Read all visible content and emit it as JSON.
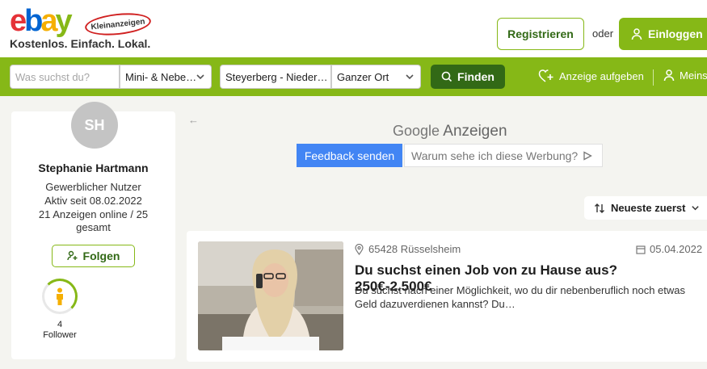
{
  "header": {
    "logo_ebay": "ebay",
    "logo_sub": "Kleinanzeigen",
    "tagline": "Kostenlos. Einfach. Lokal.",
    "register_label": "Registrieren",
    "or_label": "oder",
    "login_label": "Einloggen"
  },
  "search": {
    "query_placeholder": "Was suchst du?",
    "category_value": "Mini- & Nebe…",
    "location_value": "Steyerberg - Nieder…",
    "radius_value": "Ganzer Ort",
    "find_label": "Finden",
    "post_ad_label": "Anzeige aufgeben",
    "my_label": "Meins"
  },
  "profile": {
    "initials": "SH",
    "name": "Stephanie Hartmann",
    "type": "Gewerblicher Nutzer",
    "active_since": "Aktiv seit 08.02.2022",
    "ads_line1": "21 Anzeigen online / 25",
    "ads_line2": "gesamt",
    "follow_label": "Folgen",
    "follower_count": "4",
    "follower_label": "Follower"
  },
  "ad": {
    "back_arrow": "←",
    "google_word": "Google",
    "anzeigen_word": "Anzeigen",
    "feedback_label": "Feedback senden",
    "why_label": "Warum sehe ich diese Werbung?"
  },
  "sort": {
    "label": "Neueste zuerst"
  },
  "listing": {
    "location": "65428 Rüsselsheim",
    "date": "05.04.2022",
    "title": "Du suchst einen Job von zu Hause aus? 250€-2.500€",
    "description": "Du suchst nach einer Möglichkeit, wo du dir nebenberuflich noch etwas Geld dazuverdienen kannst? Du…"
  },
  "colors": {
    "brand_green": "#86b817",
    "dark_green": "#326916",
    "google_blue": "#4285f4"
  }
}
